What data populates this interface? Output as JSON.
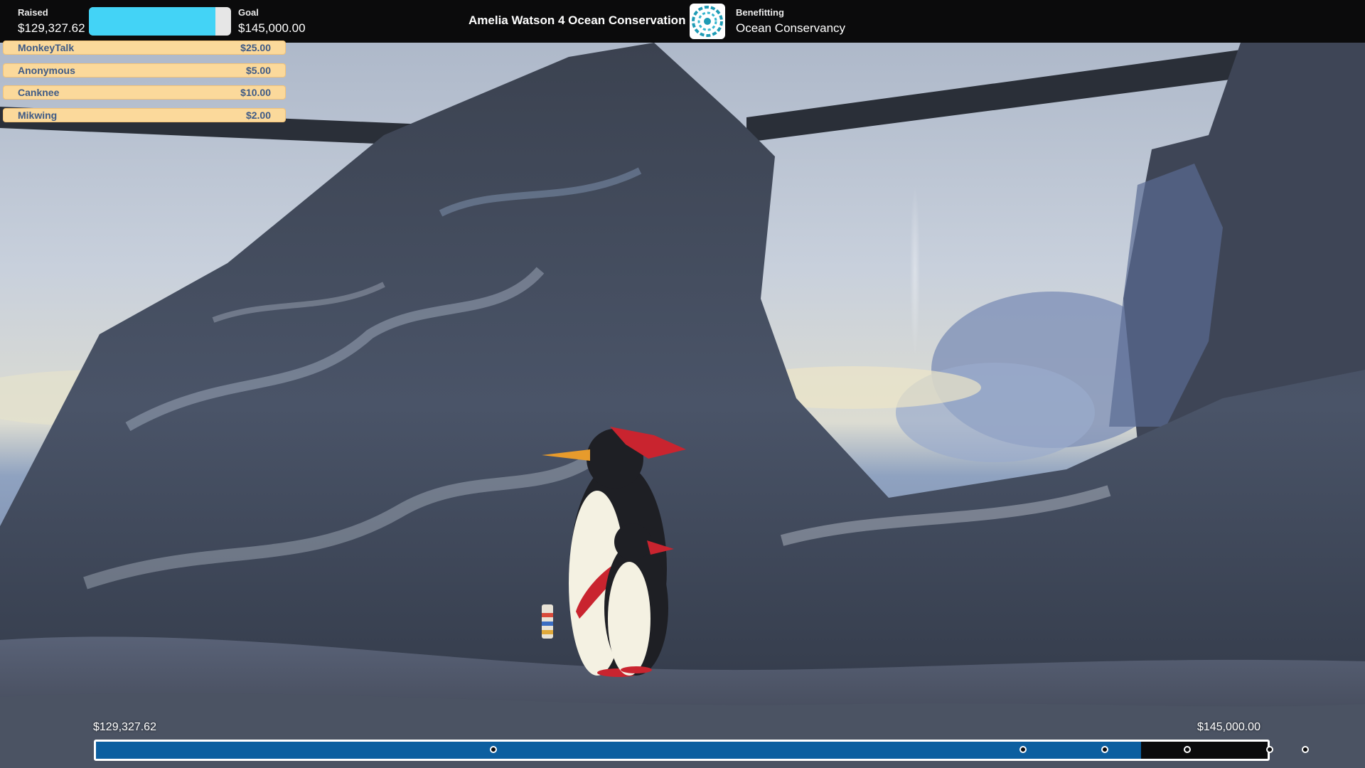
{
  "topbar": {
    "raised_label": "Raised",
    "raised_value": "$129,327.62",
    "goal_label": "Goal",
    "goal_value": "$145,000.00",
    "progress_fraction": 0.892,
    "campaign_title": "Amelia Watson 4 Ocean Conservation",
    "benefitting_label": "Benefitting",
    "charity_name": "Ocean Conservancy",
    "charity_logo_icon": "ocean-conservancy-logo",
    "accent_color": "#43d3f6"
  },
  "donations": [
    {
      "name": "MonkeyTalk",
      "amount": "$25.00"
    },
    {
      "name": "Anonymous",
      "amount": "$5.00"
    },
    {
      "name": "Canknee",
      "amount": "$10.00"
    },
    {
      "name": "Mikwing",
      "amount": "$2.00"
    }
  ],
  "bottom_progress": {
    "start_value": "$129,327.62",
    "end_value": "$145,000.00",
    "progress_fraction": 0.892,
    "fill_color": "#0c5fa0",
    "milestone_fractions": [
      0.34,
      0.79,
      0.86,
      0.93,
      1.0,
      1.03
    ]
  },
  "scene": {
    "description_icon": "penguins-on-rock-icon"
  }
}
